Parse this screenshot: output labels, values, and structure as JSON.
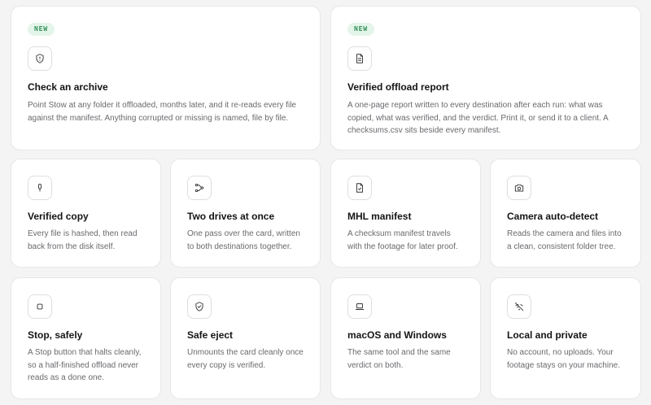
{
  "cards": [
    {
      "badge": "NEW",
      "icon": "shield-alert-icon",
      "title": "Check an archive",
      "desc": "Point Stow at any folder it offloaded, months later, and it re-reads every file against the manifest. Anything corrupted or missing is named, file by file."
    },
    {
      "badge": "NEW",
      "icon": "document-icon",
      "title": "Verified offload report",
      "desc": "A one-page report written to every destination after each run: what was copied, what was verified, and the verdict. Print it, or send it to a client. A checksums.csv sits beside every manifest."
    },
    {
      "icon": "microphone-icon",
      "title": "Verified copy",
      "desc": "Every file is hashed, then read back from the disk itself."
    },
    {
      "icon": "branch-icon",
      "title": "Two drives at once",
      "desc": "One pass over the card, written to both destinations together."
    },
    {
      "icon": "file-check-icon",
      "title": "MHL manifest",
      "desc": "A checksum manifest travels with the footage for later proof."
    },
    {
      "icon": "camera-icon",
      "title": "Camera auto-detect",
      "desc": "Reads the camera and files into a clean, consistent folder tree."
    },
    {
      "icon": "stop-icon",
      "title": "Stop, safely",
      "desc": "A Stop button that halts cleanly, so a half-finished offload never reads as a done one."
    },
    {
      "icon": "shield-check-icon",
      "title": "Safe eject",
      "desc": "Unmounts the card cleanly once every copy is verified."
    },
    {
      "icon": "laptop-icon",
      "title": "macOS and Windows",
      "desc": "The same tool and the same verdict on both."
    },
    {
      "icon": "wifi-off-icon",
      "title": "Local and private",
      "desc": "No account, no uploads. Your footage stays on your machine."
    }
  ]
}
